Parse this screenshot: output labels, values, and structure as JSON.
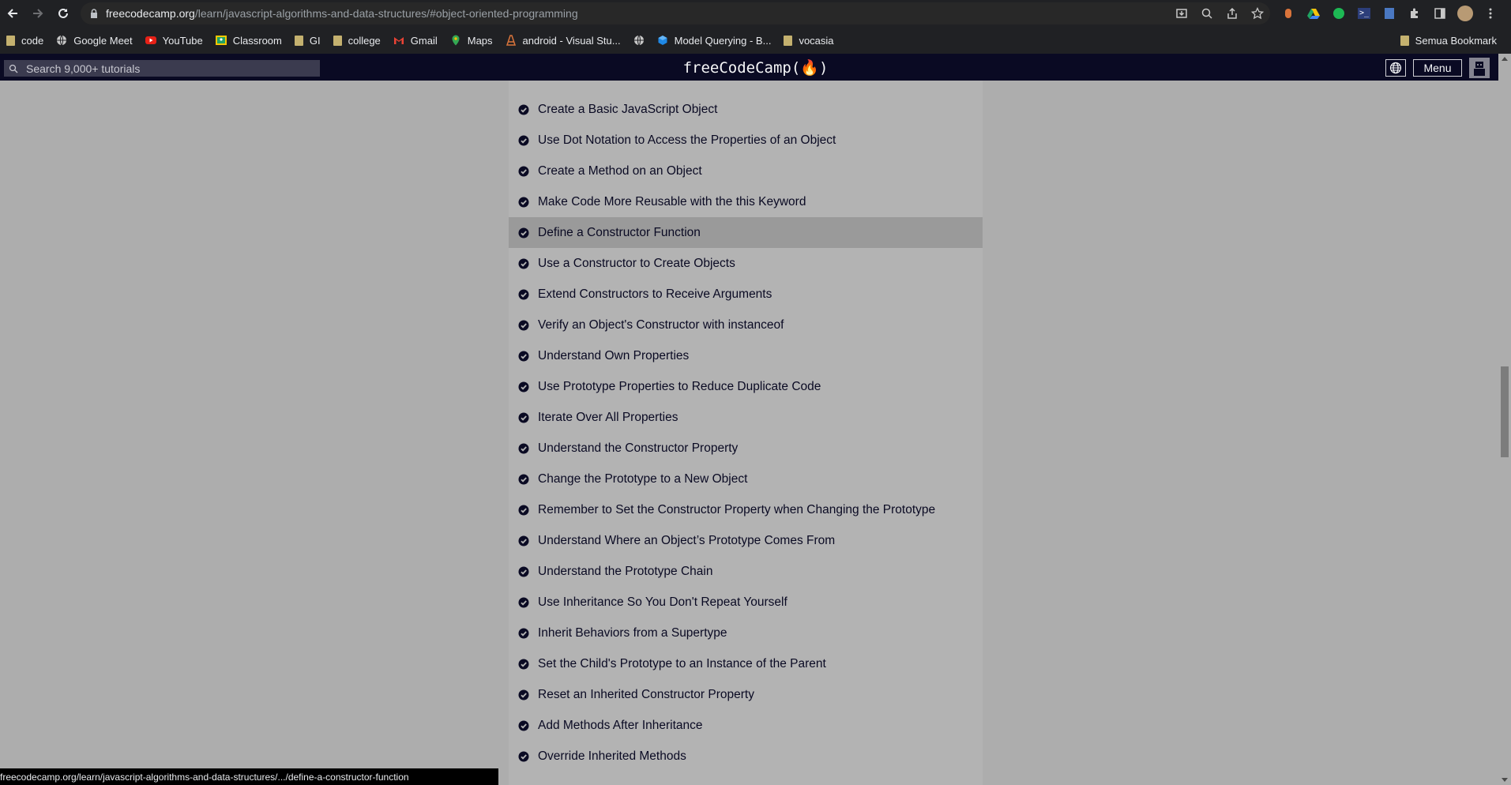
{
  "browser": {
    "url_host": "freecodecamp.org",
    "url_path": "/learn/javascript-algorithms-and-data-structures/#object-oriented-programming",
    "bookmarks": [
      {
        "label": "code",
        "icon": "folder-icon"
      },
      {
        "label": "Google Meet",
        "icon": "globe-icon"
      },
      {
        "label": "YouTube",
        "icon": "youtube-icon"
      },
      {
        "label": "Classroom",
        "icon": "classroom-icon"
      },
      {
        "label": "GI",
        "icon": "folder-icon"
      },
      {
        "label": "college",
        "icon": "folder-icon"
      },
      {
        "label": "Gmail",
        "icon": "gmail-icon"
      },
      {
        "label": "Maps",
        "icon": "maps-icon"
      },
      {
        "label": "android - Visual Stu...",
        "icon": "android-icon"
      },
      {
        "label": "",
        "icon": "globe-icon"
      },
      {
        "label": "Model Querying - B...",
        "icon": "cube-icon"
      },
      {
        "label": "vocasia",
        "icon": "folder-icon"
      }
    ],
    "all_bookmarks_label": "Semua Bookmark",
    "status_url": "freecodecamp.org/learn/javascript-algorithms-and-data-structures/.../define-a-constructor-function"
  },
  "fcc_nav": {
    "search_placeholder": "Search 9,000+ tutorials",
    "logo_text": "freeCodeCamp(🔥)",
    "menu_label": "Menu"
  },
  "challenges": [
    {
      "title": "Create a Basic JavaScript Object",
      "completed": true
    },
    {
      "title": "Use Dot Notation to Access the Properties of an Object",
      "completed": true
    },
    {
      "title": "Create a Method on an Object",
      "completed": true
    },
    {
      "title": "Make Code More Reusable with the this Keyword",
      "completed": true
    },
    {
      "title": "Define a Constructor Function",
      "completed": true,
      "highlighted": true
    },
    {
      "title": "Use a Constructor to Create Objects",
      "completed": true
    },
    {
      "title": "Extend Constructors to Receive Arguments",
      "completed": true
    },
    {
      "title": "Verify an Object's Constructor with instanceof",
      "completed": true
    },
    {
      "title": "Understand Own Properties",
      "completed": true
    },
    {
      "title": "Use Prototype Properties to Reduce Duplicate Code",
      "completed": true
    },
    {
      "title": "Iterate Over All Properties",
      "completed": true
    },
    {
      "title": "Understand the Constructor Property",
      "completed": true
    },
    {
      "title": "Change the Prototype to a New Object",
      "completed": true
    },
    {
      "title": "Remember to Set the Constructor Property when Changing the Prototype",
      "completed": true
    },
    {
      "title": "Understand Where an Object’s Prototype Comes From",
      "completed": true
    },
    {
      "title": "Understand the Prototype Chain",
      "completed": true
    },
    {
      "title": "Use Inheritance So You Don't Repeat Yourself",
      "completed": true
    },
    {
      "title": "Inherit Behaviors from a Supertype",
      "completed": true
    },
    {
      "title": "Set the Child's Prototype to an Instance of the Parent",
      "completed": true
    },
    {
      "title": "Reset an Inherited Constructor Property",
      "completed": true
    },
    {
      "title": "Add Methods After Inheritance",
      "completed": true
    },
    {
      "title": "Override Inherited Methods",
      "completed": true
    }
  ],
  "colors": {
    "fcc_nav_bg": "#0a0a23",
    "chrome_bg": "#202124",
    "content_bg": "#adadad",
    "highlight_bg": "#9a9a9a"
  }
}
